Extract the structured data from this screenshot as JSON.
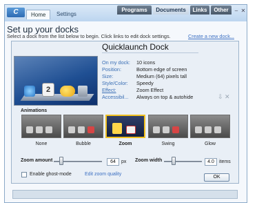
{
  "app": {
    "logo_text": "C",
    "tabs_left": [
      {
        "label": "Home"
      },
      {
        "label": "Settings"
      }
    ],
    "tabs_top": [
      {
        "label": "Programs"
      },
      {
        "label": "Documents"
      },
      {
        "label": "Links"
      },
      {
        "label": "Other"
      }
    ],
    "active_top_tab": "Documents",
    "window_controls": {
      "minimize": "–",
      "close": "✕"
    }
  },
  "page": {
    "title": "Set up your docks",
    "subtitle": "Select a dock from the list below to begin. Click links to edit dock settings.",
    "create_link": "Create a new dock..."
  },
  "dock": {
    "name": "Quicklaunch Dock",
    "properties": [
      {
        "label": "On my dock:",
        "value": "10 icons"
      },
      {
        "label": "Position:",
        "value": "Bottom edge of screen"
      },
      {
        "label": "Size:",
        "value": "Medium (64) pixels tall"
      },
      {
        "label": "Style/Color:",
        "value": "Speedy"
      },
      {
        "label": "Effect:",
        "value": "Zoom Effect"
      },
      {
        "label": "Accessibil...",
        "value": "Always on top & autohide"
      }
    ],
    "preview_calendar_day": "2"
  },
  "animations": {
    "label": "Animations",
    "options": [
      "None",
      "Bubble",
      "Zoom",
      "Swing",
      "Glow"
    ],
    "selected": "Zoom"
  },
  "zoom_amount": {
    "label": "Zoom amount",
    "value": "64",
    "unit": "px",
    "slider_fraction": 0.15
  },
  "zoom_width": {
    "label": "Zoom width",
    "value": "4.0",
    "unit": "items",
    "slider_fraction": 0.25
  },
  "ghost_mode": {
    "label": "Enable ghost-mode",
    "checked": false
  },
  "edit_zoom_link": "Edit zoom quality",
  "ok_button": "OK",
  "colors": {
    "accent": "#3b6fc2",
    "selected_border": "#f0c020",
    "tab_dark": "#4a5868"
  },
  "icons": [
    "calendar-icon",
    "weather-icon",
    "mail-icon",
    "trash-icon",
    "lock-icon"
  ]
}
